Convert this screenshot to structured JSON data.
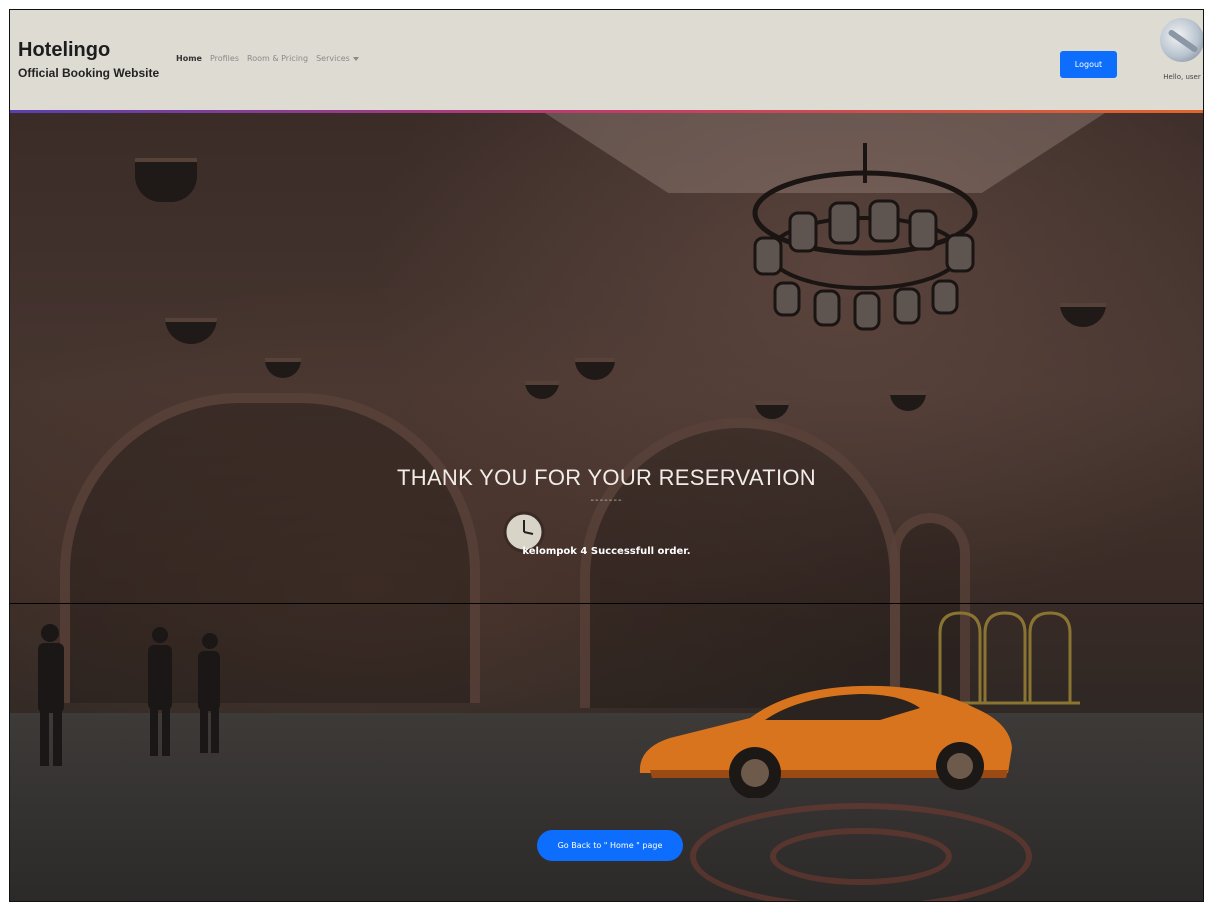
{
  "navbar": {
    "brand_title": "Hotelingo",
    "brand_subtitle": "Official Booking Website",
    "links": [
      {
        "label": "Home",
        "active": true
      },
      {
        "label": "Profiles",
        "active": false
      },
      {
        "label": "Room & Pricing",
        "active": false
      },
      {
        "label": "Services",
        "active": false,
        "dropdown": true
      }
    ],
    "logout_label": "Logout",
    "greeting": "Hello, user",
    "accent_colors": [
      "#5b3fb0",
      "#c23b6a",
      "#e0652a"
    ]
  },
  "hero": {
    "title": "THANK YOU FOR YOUR RESERVATION",
    "dashes": "-------",
    "message": "kelompok 4 Successfull order.",
    "home_button_label": "Go Back to \" Home \" page"
  },
  "colors": {
    "primary_button": "#0d6efd",
    "navbar_bg": "#dedbd3"
  }
}
